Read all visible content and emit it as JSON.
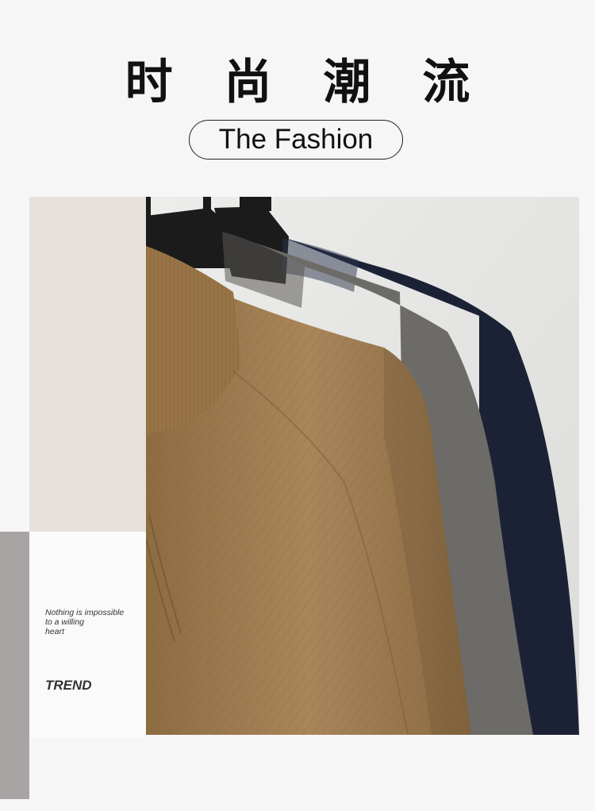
{
  "header": {
    "title": "时 尚 潮 流",
    "subtitle": "The Fashion"
  },
  "side_panel": {
    "tagline": "Nothing is impossible\n to a willing\n heart",
    "label": "TREND"
  },
  "photo": {
    "subject": "three knit sweaters on hangers",
    "colors": {
      "camel": "#a07d4f",
      "grey": "#6d6b67",
      "navy": "#1c2236",
      "background": "#e6e6e4"
    }
  }
}
